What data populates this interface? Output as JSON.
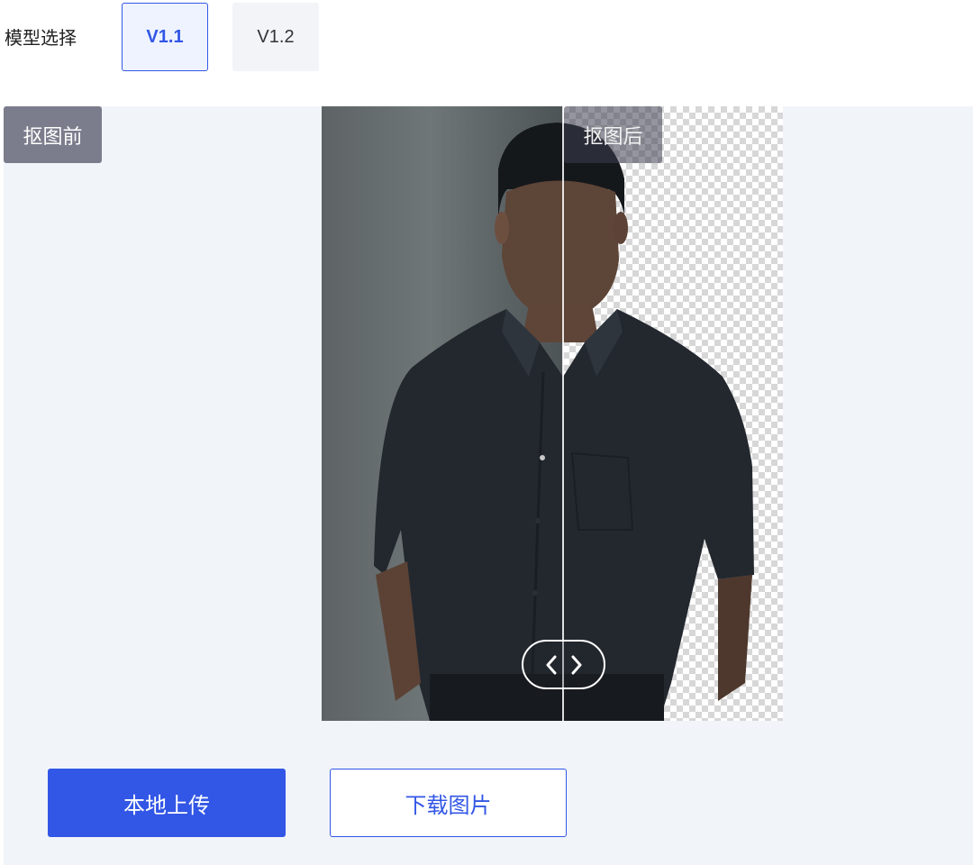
{
  "model_select": {
    "label": "模型选择",
    "options": [
      "V1.1",
      "V1.2"
    ],
    "selected": "V1.1"
  },
  "compare": {
    "before_label": "抠图前",
    "after_label": "抠图后",
    "slider_position": 0.52,
    "handle_icons": [
      "chevron-left-icon",
      "chevron-right-icon"
    ]
  },
  "actions": {
    "upload_label": "本地上传",
    "download_label": "下载图片"
  },
  "colors": {
    "accent": "#3256e6",
    "stage_bg": "#f1f4f9",
    "tag_bg": "#7b7d8c"
  }
}
